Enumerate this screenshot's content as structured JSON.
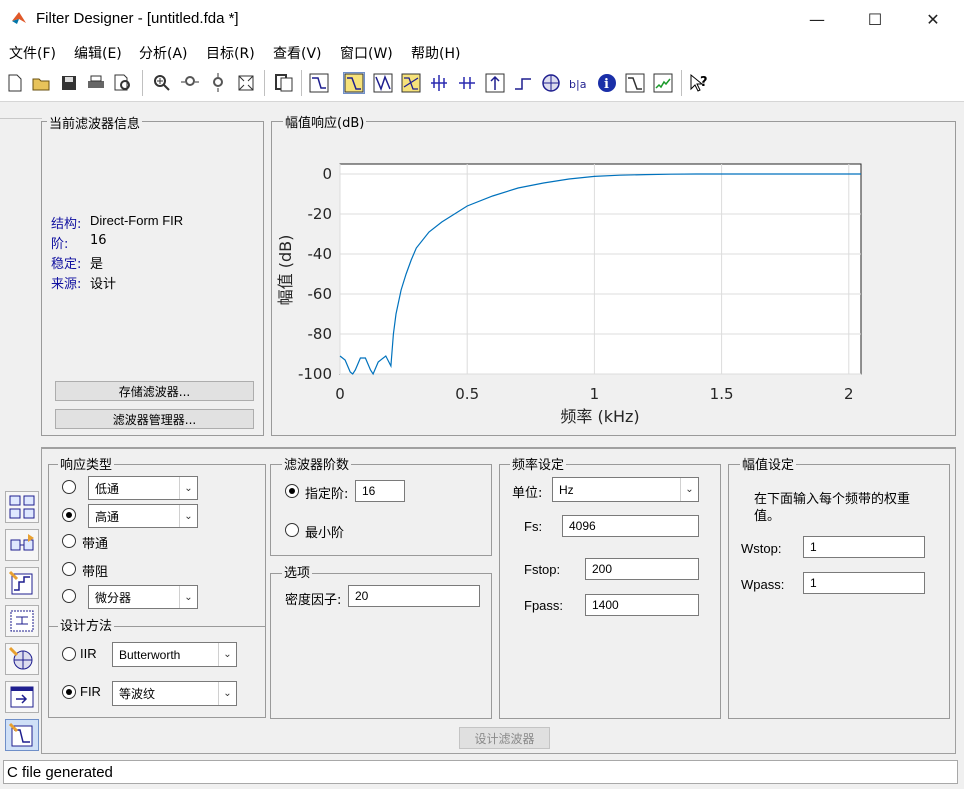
{
  "window": {
    "title": "Filter Designer - [untitled.fda *]",
    "minimize": "—",
    "maximize": "☐",
    "close": "✕"
  },
  "menu": [
    "文件(F)",
    "编辑(E)",
    "分析(A)",
    "目标(R)",
    "查看(V)",
    "窗口(W)",
    "帮助(H)"
  ],
  "toolbar": {
    "icons": [
      "new-icon",
      "open-icon",
      "save-icon",
      "print-icon",
      "print-preview-icon",
      "zoom-in-icon",
      "zoom-x-icon",
      "zoom-y-icon",
      "full-view-icon",
      "new-figure-icon",
      "filter-spec-icon",
      "magnitude-response-icon",
      "phase-response-icon",
      "magnitude-phase-icon",
      "group-delay-icon",
      "phase-delay-icon",
      "impulse-response-icon",
      "step-response-icon",
      "pole-zero-icon",
      "coefficients-icon",
      "filter-info-icon",
      "magnitude-estimate-icon",
      "round-off-noise-icon",
      "whats-this-icon"
    ],
    "selected": "magnitude-response-icon"
  },
  "current_filter": {
    "title": "当前滤波器信息",
    "structure_label": "结构:",
    "structure_value": "Direct-Form FIR",
    "order_label": "阶:",
    "order_value": "16",
    "stable_label": "稳定:",
    "stable_value": "是",
    "source_label": "来源:",
    "source_value": "设计",
    "store_button": "存储滤波器...",
    "manager_button": "滤波器管理器..."
  },
  "plot_panel": {
    "title": "幅值响应(dB)"
  },
  "chart_data": {
    "type": "line",
    "title": "",
    "xlabel": "频率 (kHz)",
    "ylabel": "幅值 (dB)",
    "xlim": [
      0,
      2.048
    ],
    "ylim": [
      -100,
      5
    ],
    "xticks": [
      "0",
      "0.5",
      "1",
      "1.5",
      "2"
    ],
    "yticks": [
      "0",
      "-20",
      "-40",
      "-60",
      "-80",
      "-100"
    ],
    "grid": true,
    "series": [
      {
        "color": "#0072bd",
        "x": [
          0,
          0.02,
          0.04,
          0.05,
          0.06,
          0.08,
          0.1,
          0.12,
          0.13,
          0.15,
          0.18,
          0.2,
          0.21,
          0.22,
          0.24,
          0.26,
          0.28,
          0.3,
          0.35,
          0.4,
          0.45,
          0.5,
          0.6,
          0.7,
          0.8,
          0.9,
          1.0,
          1.1,
          1.2,
          1.3,
          1.4,
          1.5,
          1.7,
          1.9,
          2.048
        ],
        "y": [
          -91,
          -93,
          -99,
          -100,
          -98,
          -92,
          -92,
          -98,
          -100,
          -94,
          -91,
          -96,
          -80,
          -70,
          -58,
          -50,
          -43,
          -37,
          -29,
          -24,
          -20,
          -16,
          -11,
          -7,
          -4.5,
          -2.5,
          -1.2,
          -0.6,
          -0.3,
          -0.1,
          0,
          0,
          0,
          0,
          0
        ]
      }
    ]
  },
  "response_type": {
    "title": "响应类型",
    "options": [
      {
        "label": "低通",
        "checked": false
      },
      {
        "label": "高通",
        "checked": true
      },
      {
        "label": "带通",
        "checked": false
      },
      {
        "label": "带阻",
        "checked": false
      },
      {
        "label": "微分器",
        "checked": false
      }
    ]
  },
  "design_method": {
    "title": "设计方法",
    "iir_label": "IIR",
    "iir_value": "Butterworth",
    "iir_checked": false,
    "fir_label": "FIR",
    "fir_value": "等波纹",
    "fir_checked": true
  },
  "filter_order": {
    "title": "滤波器阶数",
    "specify_label": "指定阶:",
    "specify_value": "16",
    "specify_checked": true,
    "minimum_label": "最小阶",
    "minimum_checked": false
  },
  "options": {
    "title": "选项",
    "density_label": "密度因子:",
    "density_value": "20"
  },
  "frequency_spec": {
    "title": "频率设定",
    "units_label": "单位:",
    "units_value": "Hz",
    "fs_label": "Fs:",
    "fs_value": "4096",
    "fstop_label": "Fstop:",
    "fstop_value": "200",
    "fpass_label": "Fpass:",
    "fpass_value": "1400"
  },
  "magnitude_spec": {
    "title": "幅值设定",
    "description": "在下面输入每个频带的权重值。",
    "wstop_label": "Wstop:",
    "wstop_value": "1",
    "wpass_label": "Wpass:",
    "wpass_value": "1"
  },
  "design_button": "设计滤波器",
  "sidebar": [
    "transform-icon",
    "realize-model-icon",
    "create-multirate-icon",
    "convert-structure-icon",
    "pole-zero-editor-icon",
    "import-filter-icon",
    "design-filter-icon"
  ],
  "status": "C file generated"
}
